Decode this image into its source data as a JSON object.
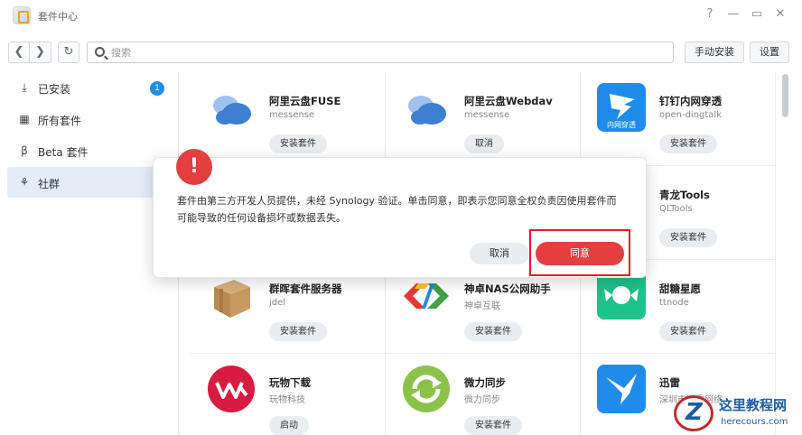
{
  "window": {
    "title": "套件中心",
    "controls": [
      "?",
      "—",
      "▭",
      "✕"
    ]
  },
  "toolbar": {
    "back": "❮",
    "forward": "❯",
    "refresh": "↻",
    "search_placeholder": "搜索",
    "manual_install": "手动安装",
    "settings": "设置"
  },
  "sidebar": {
    "items": [
      {
        "label": "已安装",
        "icon": "download-icon",
        "glyph": "⤓",
        "badge": "1"
      },
      {
        "label": "所有套件",
        "icon": "grid-icon",
        "glyph": "▦"
      },
      {
        "label": "Beta 套件",
        "icon": "beta-icon",
        "glyph": "β"
      },
      {
        "label": "社群",
        "icon": "community-icon",
        "glyph": "⚘"
      }
    ]
  },
  "packages": [
    {
      "name": "阿里云盘FUSE",
      "developer": "messense",
      "button": "安装套件"
    },
    {
      "name": "阿里云盘Webdav",
      "developer": "messense",
      "button": "取消"
    },
    {
      "name": "钉钉内网穿透",
      "developer": "open-dingtalk",
      "button": "安装套件",
      "icon_text": "内网穿透"
    },
    {
      "name": "",
      "developer": "",
      "button": ""
    },
    {
      "name": "",
      "developer": "",
      "button": ""
    },
    {
      "name": "青龙Tools",
      "developer": "QLTools",
      "button": "安装套件"
    },
    {
      "name": "群晖套件服务器",
      "developer": "jdel",
      "button": "安装套件"
    },
    {
      "name": "神卓NAS公网助手",
      "developer": "神卓互联",
      "button": "安装套件"
    },
    {
      "name": "甜糖星愿",
      "developer": "ttnode",
      "button": "安装套件"
    },
    {
      "name": "玩物下载",
      "developer": "玩物科技",
      "button": "启动"
    },
    {
      "name": "微力同步",
      "developer": "微力同步",
      "button": "安装套件"
    },
    {
      "name": "迅雷",
      "developer": "深圳市迅雷网络",
      "button": ""
    }
  ],
  "modal": {
    "icon": "!",
    "message": "套件由第三方开发人员提供，未经 Synology 验证。单击同意，即表示您同意全权负责因使用套件而可能导致的任何设备损坏或数据丢失。",
    "cancel": "取消",
    "agree": "同意"
  },
  "watermark": {
    "title": "这里教程网",
    "url": "herecours.com"
  },
  "colors": {
    "accent": "#1f8ceb",
    "danger": "#e53e3e",
    "sidebar_active": "#e4ecf7"
  }
}
